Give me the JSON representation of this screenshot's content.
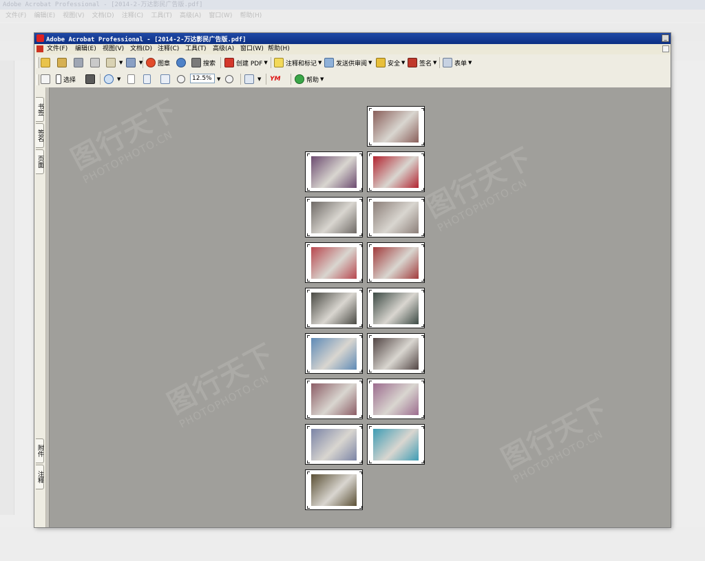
{
  "background_window": {
    "title": "Adobe Acrobat Professional - [2014-2-万达影民广告版.pdf]",
    "menu": [
      "文件(F)",
      "编辑(E)",
      "视图(V)",
      "文档(D)",
      "注释(C)",
      "工具(T)",
      "高级(A)",
      "窗口(W)",
      "帮助(H)"
    ]
  },
  "window": {
    "title": "Adobe Acrobat Professional - [2014-2-万达影民广告版.pdf]"
  },
  "menu": [
    "文件(F)",
    "编辑(E)",
    "视图(V)",
    "文档(D)",
    "注释(C)",
    "工具(T)",
    "高级(A)",
    "窗口(W)",
    "帮助(H)"
  ],
  "toolbar1": {
    "stamp_label": "图章",
    "search_label": "搜索",
    "create_pdf_label": "创建 PDF",
    "comment_label": "注释和标记",
    "review_label": "发送供审阅",
    "security_label": "安全",
    "sign_label": "签名",
    "forms_label": "表单"
  },
  "toolbar2": {
    "select_label": "选择",
    "zoom_value": "12.5%",
    "help_label": "帮助",
    "ym_label": "YM"
  },
  "left_tabs": [
    "书签",
    "签名",
    "页面",
    "附件",
    "注释"
  ],
  "watermark": {
    "cn": "图行天下",
    "en": "PHOTOPHOTO.CN"
  },
  "thumbnails": [
    {
      "page": 1,
      "col": "right",
      "row": 0,
      "color": "#8a5f5a"
    },
    {
      "page": 2,
      "col": "left",
      "row": 1,
      "color": "#6c4b70"
    },
    {
      "page": 3,
      "col": "right",
      "row": 1,
      "color": "#b2232f"
    },
    {
      "page": 4,
      "col": "left",
      "row": 2,
      "color": "#6f6a66"
    },
    {
      "page": 5,
      "col": "right",
      "row": 2,
      "color": "#8c7f79"
    },
    {
      "page": 6,
      "col": "left",
      "row": 3,
      "color": "#b8474e"
    },
    {
      "page": 7,
      "col": "right",
      "row": 3,
      "color": "#a13a3b"
    },
    {
      "page": 8,
      "col": "left",
      "row": 4,
      "color": "#4a4a44"
    },
    {
      "page": 9,
      "col": "right",
      "row": 4,
      "color": "#3c4a44"
    },
    {
      "page": 10,
      "col": "left",
      "row": 5,
      "color": "#5e8ab6"
    },
    {
      "page": 11,
      "col": "right",
      "row": 5,
      "color": "#524544"
    },
    {
      "page": 12,
      "col": "left",
      "row": 6,
      "color": "#8c5d66"
    },
    {
      "page": 13,
      "col": "right",
      "row": 6,
      "color": "#9c6c8e"
    },
    {
      "page": 14,
      "col": "left",
      "row": 7,
      "color": "#7b84a6"
    },
    {
      "page": 15,
      "col": "right",
      "row": 7,
      "color": "#3e9cb4"
    },
    {
      "page": 16,
      "col": "left",
      "row": 8,
      "color": "#5b5035"
    }
  ]
}
